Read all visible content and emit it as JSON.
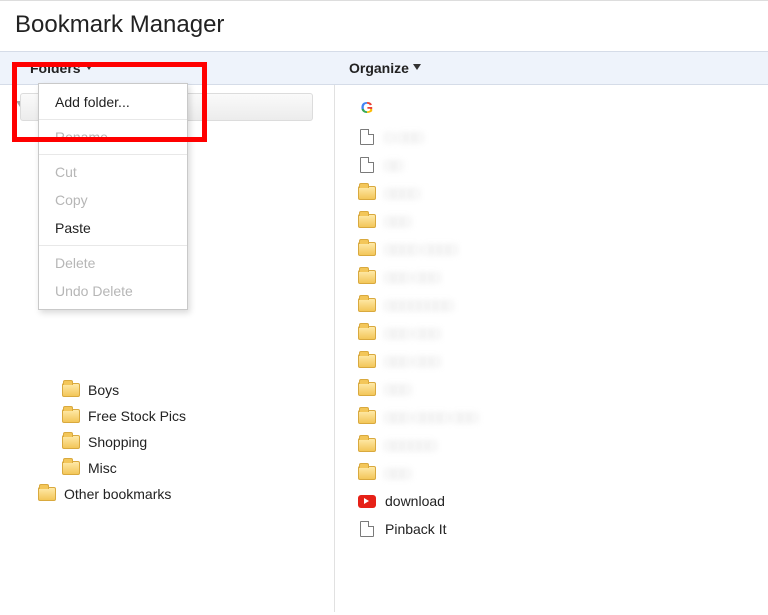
{
  "title": "Bookmark Manager",
  "menu": {
    "folders_label": "Folders",
    "organize_label": "Organize"
  },
  "dropdown": {
    "add_folder": "Add folder...",
    "rename": "Rename...",
    "cut": "Cut",
    "copy": "Copy",
    "paste": "Paste",
    "delete": "Delete",
    "undo_delete": "Undo Delete"
  },
  "tree": {
    "boys": "Boys",
    "free_stock_pics": "Free Stock Pics",
    "shopping": "Shopping",
    "misc": "Misc",
    "other_bookmarks": "Other bookmarks"
  },
  "right": {
    "google": "",
    "p1": "□ □□□",
    "p2": "□□",
    "f1": "□□□□",
    "f2": "□□□",
    "f3": "□□□□ □□□□",
    "f4": "□□□ □□□",
    "f5": "□□□□□□□□",
    "f6": "□□□ □□□",
    "f7": "□□□ □□□",
    "f8": "□□□",
    "f9": "□□□ □□□□ □□□",
    "f10": "□□□□□□",
    "f11": "□□□",
    "download": "download",
    "pinback": "Pinback It"
  }
}
